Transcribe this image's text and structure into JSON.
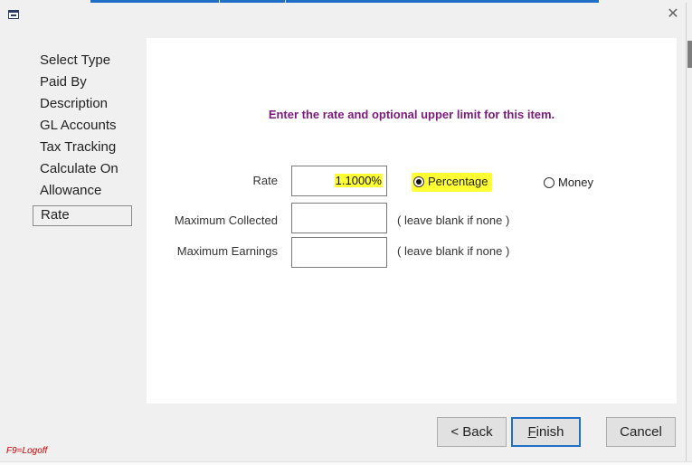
{
  "steps": [
    {
      "label": "Select Type"
    },
    {
      "label": "Paid By"
    },
    {
      "label": "Description"
    },
    {
      "label": "GL Accounts"
    },
    {
      "label": "Tax Tracking"
    },
    {
      "label": "Calculate On"
    },
    {
      "label": "Allowance"
    },
    {
      "label": "Rate"
    }
  ],
  "active_step": "Rate",
  "instruction": "Enter the rate and optional upper limit for this item.",
  "form": {
    "rate_label": "Rate",
    "rate_value": "1.1000%",
    "max_collected_label": "Maximum Collected",
    "max_collected_value": "",
    "max_collected_hint": "( leave blank if none )",
    "max_earnings_label": "Maximum Earnings",
    "max_earnings_value": "",
    "max_earnings_hint": "( leave blank if none )"
  },
  "rate_type": {
    "options": [
      {
        "label": "Percentage",
        "checked": true
      },
      {
        "label": "Money",
        "checked": false
      }
    ]
  },
  "buttons": {
    "back": "< Back",
    "finish_underlined": "F",
    "finish_rest": "inish",
    "cancel": "Cancel"
  },
  "footer": {
    "logoff": "F9=Logoff"
  },
  "icons": {
    "app": "app-window-icon",
    "close": "close-icon"
  },
  "colors": {
    "instruction": "#7b1a7b",
    "highlight": "#ffff33",
    "accent": "#1f6fc9",
    "logoff": "#cc0000"
  }
}
